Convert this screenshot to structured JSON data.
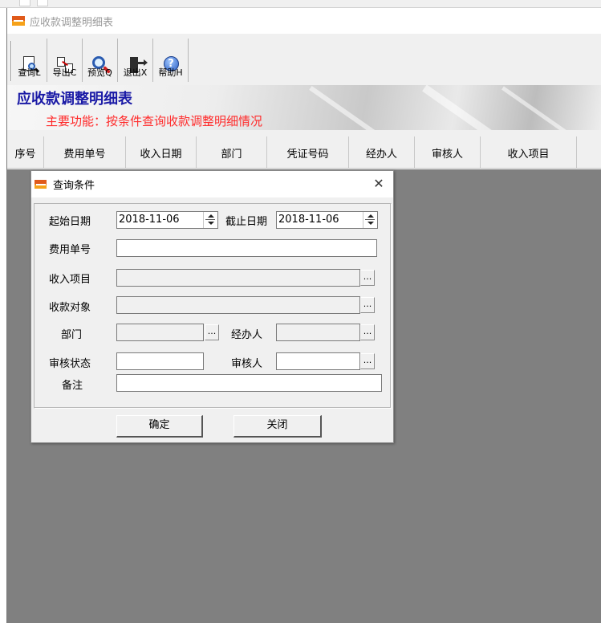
{
  "window": {
    "title": "应收款调整明细表"
  },
  "toolbar": {
    "buttons": [
      {
        "label": "查询L",
        "icon": "query-icon"
      },
      {
        "label": "导出C",
        "icon": "export-icon"
      },
      {
        "label": "预览Q",
        "icon": "preview-icon"
      },
      {
        "label": "退出X",
        "icon": "exit-icon"
      },
      {
        "label": "帮助H",
        "icon": "help-icon"
      }
    ]
  },
  "banner": {
    "title": "应收款调整明细表",
    "subtitle": "主要功能：按条件查询收款调整明细情况"
  },
  "grid": {
    "columns": [
      "序号",
      "费用单号",
      "收入日期",
      "部门",
      "凭证号码",
      "经办人",
      "审核人",
      "收入项目"
    ]
  },
  "dialog": {
    "title": "查询条件",
    "close_symbol": "X",
    "fields": {
      "start_date_label": "起始日期",
      "start_date_value": "2018-11-06",
      "end_date_label": "截止日期",
      "end_date_value": "2018-11-06",
      "expense_no_label": "费用单号",
      "expense_no_value": "",
      "income_item_label": "收入项目",
      "income_item_value": "",
      "payer_label": "收款对象",
      "payer_value": "",
      "dept_label": "部门",
      "dept_value": "",
      "handler_label": "经办人",
      "handler_value": "",
      "audit_status_label": "审核状态",
      "audit_status_value": "",
      "auditor_label": "审核人",
      "auditor_value": "",
      "remark_label": "备注",
      "remark_value": ""
    },
    "ellipsis": "...",
    "ok_label": "确定",
    "close_label": "关闭"
  },
  "colors": {
    "banner_title": "#1a1aa6",
    "banner_subtitle": "#ff2b2b",
    "grid_background": "#808080"
  }
}
